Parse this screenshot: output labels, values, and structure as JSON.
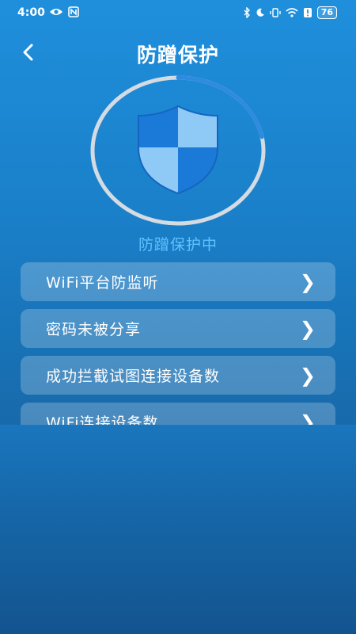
{
  "status_bar": {
    "time": "4:00",
    "battery": "76"
  },
  "header": {
    "title": "防蹭保护"
  },
  "protection": {
    "status_text": "防蹭保护中",
    "progress": 0.22,
    "colors": {
      "ring_track": "#d4dbe2",
      "ring_progress": "#2e8bdf",
      "shield_fill": "#1b79d8",
      "shield_light": "#8fcaf7",
      "status_text": "#5fc3ff"
    }
  },
  "list": {
    "items": [
      {
        "label": "WiFi平台防监听",
        "chevron": "❯"
      },
      {
        "label": "密码未被分享",
        "chevron": "❯"
      },
      {
        "label": "成功拦截试图连接设备数",
        "chevron": "❯"
      },
      {
        "label": "WiFi连接设备数",
        "chevron": "❯"
      }
    ]
  },
  "icons": {
    "back": "chevron-left-icon",
    "shield": "shield-icon",
    "bluetooth": "bluetooth-icon",
    "moon": "moon-icon",
    "vibrate": "vibrate-icon",
    "wifi": "wifi-icon",
    "alert": "alert-icon",
    "battery": "battery-icon",
    "eye": "eye-icon",
    "nfc": "nfc-icon"
  }
}
